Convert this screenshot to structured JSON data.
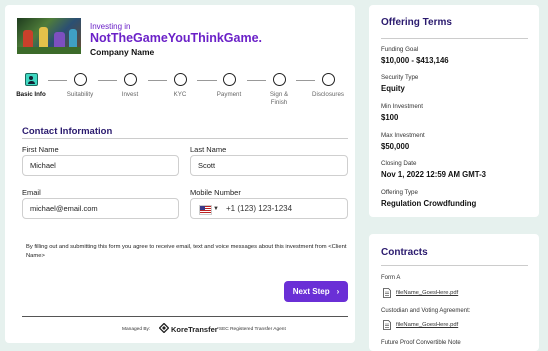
{
  "header": {
    "investing_in": "Investing in",
    "offering_name": "NotTheGameYouThinkGame.",
    "company_name": "Company Name"
  },
  "steps": [
    {
      "label": "Basic Info",
      "active": true
    },
    {
      "label": "Suitability",
      "active": false
    },
    {
      "label": "Invest",
      "active": false
    },
    {
      "label": "KYC",
      "active": false
    },
    {
      "label": "Payment",
      "active": false
    },
    {
      "label": "Sign & Finish",
      "active": false
    },
    {
      "label": "Disclosures",
      "active": false
    }
  ],
  "form": {
    "section_title": "Contact  Information",
    "first_name": {
      "label": "First Name",
      "value": "Michael"
    },
    "last_name": {
      "label": "Last Name",
      "value": "Scott"
    },
    "email": {
      "label": "Email",
      "value": "michael@email.com"
    },
    "mobile": {
      "label": "Mobile Number",
      "value": "+1 (123) 123-1234",
      "country_icon": "us-flag-icon"
    },
    "disclaimer": "By filling out and submitting this form you agree to receive email, text and voice messages about this investment from <Client Name>",
    "next_label": "Next Step"
  },
  "footer": {
    "managed_by": "Managed By:",
    "brand": "KoreTransfer",
    "sec_note": "*SEC Registered Transfer Agent"
  },
  "terms": {
    "title": "Offering Terms",
    "items": [
      {
        "key": "Funding Goal",
        "value": "$10,000 - $413,146"
      },
      {
        "key": "Security Type",
        "value": "Equity"
      },
      {
        "key": "Min Investment",
        "value": "$100"
      },
      {
        "key": "Max Investment",
        "value": "$50,000"
      },
      {
        "key": "Closing Date",
        "value": "Nov 1, 2022 12:59 AM GMT-3"
      },
      {
        "key": "Offering Type",
        "value": "Regulation Crowdfunding"
      }
    ]
  },
  "contracts": {
    "title": "Contracts",
    "items": [
      {
        "label": "Form A",
        "file": "fileName_GoesHere.pdf"
      },
      {
        "label": "Custodian and Voting Agreement:",
        "file": "fileName_GoesHere.pdf"
      },
      {
        "label": "Future Proof Convertible Note",
        "file": ""
      }
    ]
  },
  "colors": {
    "background": "#e6f1ee",
    "accent": "#6a2fd6",
    "heading": "#2a1a6e",
    "active_step": "#40d8c2"
  }
}
